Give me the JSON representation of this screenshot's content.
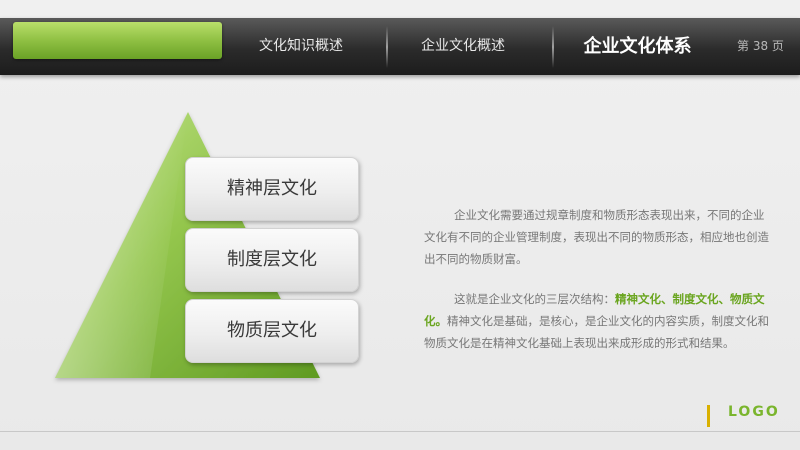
{
  "nav": {
    "items": [
      {
        "label": "文化知识概述"
      },
      {
        "label": "企业文化概述"
      },
      {
        "label": "企业文化体系"
      }
    ],
    "page_number": "第 38 页"
  },
  "pyramid": {
    "levels": [
      {
        "label": "精神层文化"
      },
      {
        "label": "制度层文化"
      },
      {
        "label": "物质层文化"
      }
    ]
  },
  "content": {
    "paragraph1": "企业文化需要通过规章制度和物质形态表现出来，不同的企业文化有不同的企业管理制度，表现出不同的物质形态，相应地也创造出不同的物质财富。",
    "paragraph2_prefix": "这就是企业文化的三层次结构：",
    "paragraph2_highlight": "精神文化、制度文化、物质文化。",
    "paragraph2_rest": "精神文化是基础，是核心，是企业文化的内容实质，制度文化和物质文化是在精神文化基础上表现出来成形成的形式和结果。"
  },
  "footer": {
    "logo": "LOGO"
  },
  "colors": {
    "accent_green": "#7ab52d",
    "topbar_dark": "#2b2b2b",
    "divider_gold": "#d9b000"
  }
}
